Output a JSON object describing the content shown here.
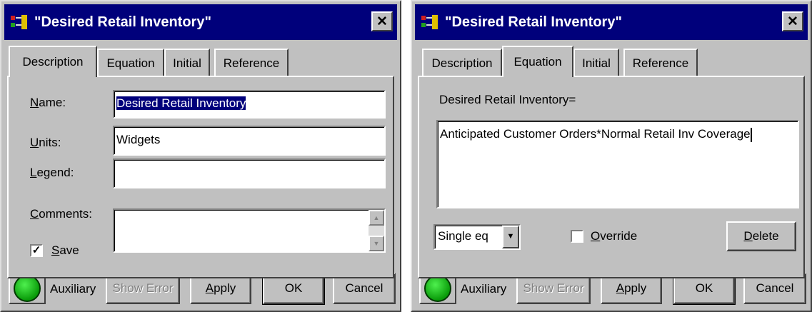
{
  "left_dialog": {
    "title": "\"Desired Retail Inventory\"",
    "close_label": "✕",
    "tabs": [
      {
        "label": "Description"
      },
      {
        "label": "Equation"
      },
      {
        "label": "Initial"
      },
      {
        "label": "Reference"
      }
    ],
    "active_tab": "Description",
    "name_label_first": "N",
    "name_label_rest": "ame:",
    "name_value": "Desired Retail Inventory",
    "units_label_first": "U",
    "units_label_rest": "nits:",
    "units_value": "Widgets",
    "legend_label_first": "L",
    "legend_label_rest": "egend:",
    "legend_value": "",
    "comments_label_first": "C",
    "comments_label_rest": "omments:",
    "comments_value": "",
    "save_label_first": "S",
    "save_label_rest": "ave",
    "save_checked": "✓",
    "type_label": "Auxiliary",
    "show_error_label": "Show Error",
    "apply_label_first": "A",
    "apply_label_rest": "pply",
    "ok_label": "OK",
    "cancel_label": "Cancel"
  },
  "right_dialog": {
    "title": "\"Desired Retail Inventory\"",
    "close_label": "✕",
    "tabs": [
      {
        "label": "Description"
      },
      {
        "label": "Equation"
      },
      {
        "label": "Initial"
      },
      {
        "label": "Reference"
      }
    ],
    "active_tab": "Equation",
    "equation_header": "Desired Retail Inventory=",
    "equation_value": "Anticipated Customer Orders*Normal Retail Inv Coverage",
    "eq_type_value": "Single eq",
    "override_label_first": "O",
    "override_label_rest": "verride",
    "delete_label_first": "D",
    "delete_label_rest": "elete",
    "type_label": "Auxiliary",
    "show_error_label": "Show Error",
    "apply_label_first": "A",
    "apply_label_rest": "pply",
    "ok_label": "OK",
    "cancel_label": "Cancel"
  },
  "colors": {
    "titlebar": "#00007b",
    "dialog_face": "#c0c0c0",
    "status_dot": "#1ec41e"
  }
}
